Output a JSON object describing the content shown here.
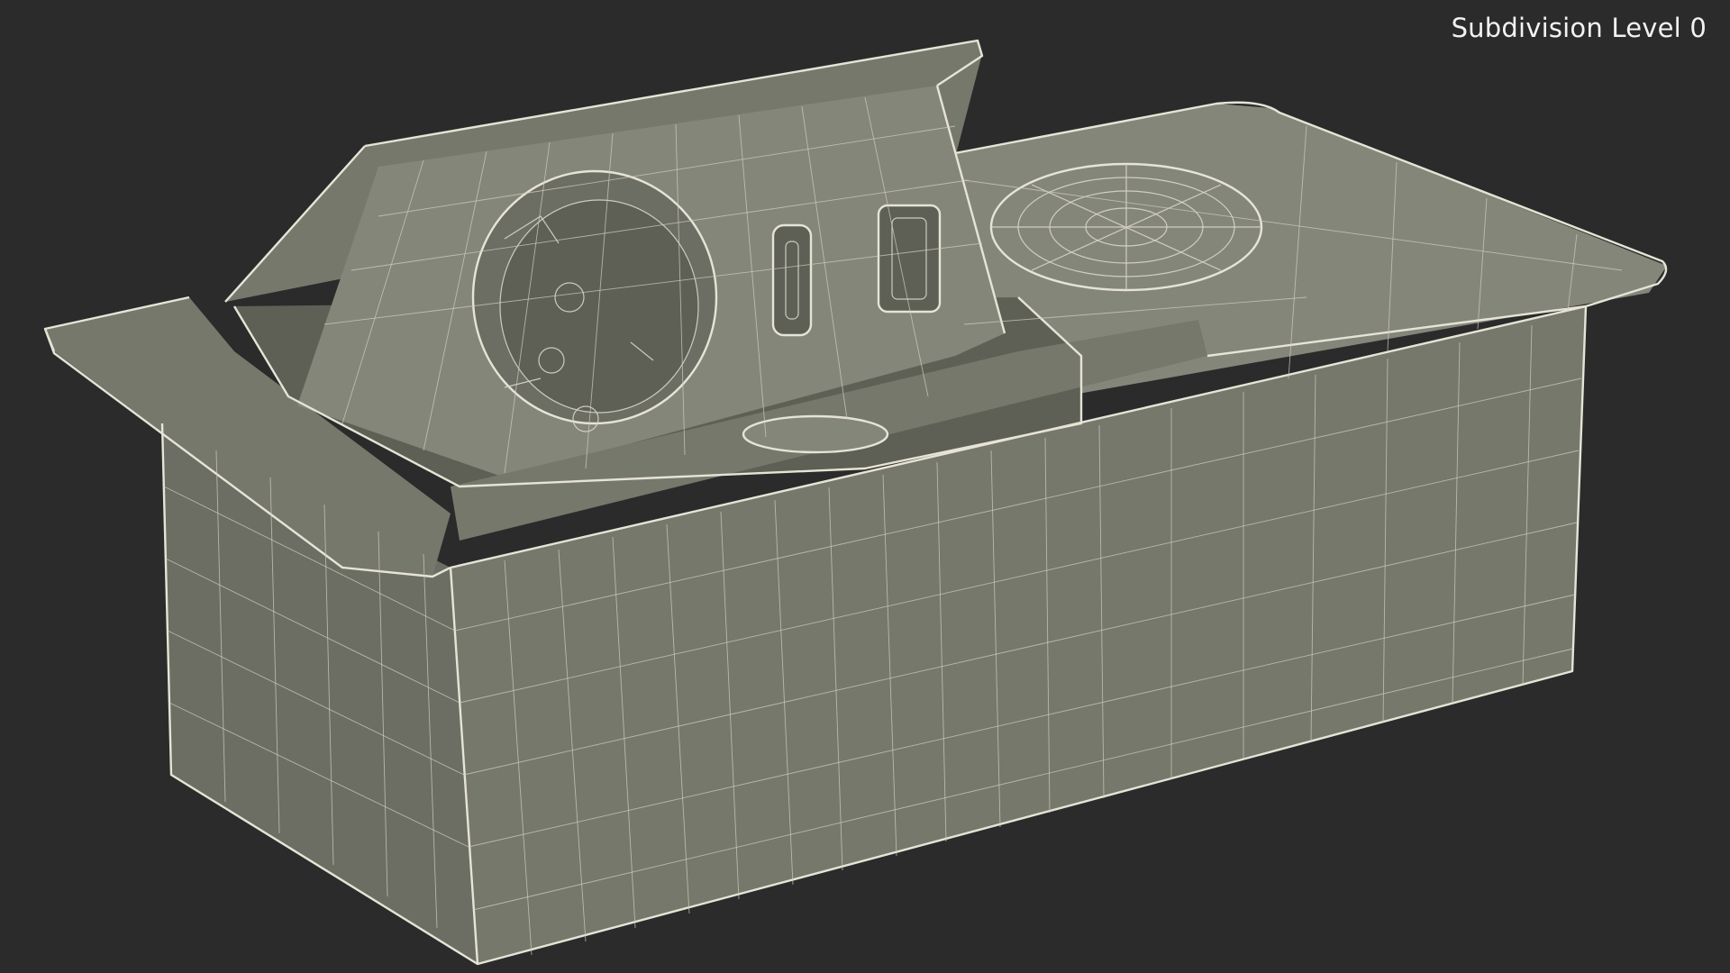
{
  "viewport": {
    "background_color": "#2b2b2b",
    "model_color": "#77786c",
    "wire_color": "#e6e4d6",
    "label": "Subdivision Level 0"
  }
}
